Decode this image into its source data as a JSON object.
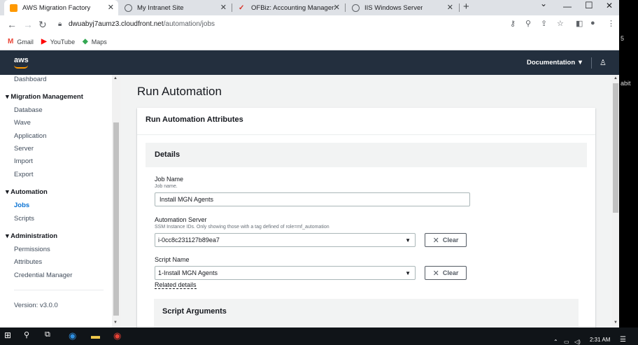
{
  "browser": {
    "tabs": [
      {
        "title": "AWS Migration Factory",
        "icon": "aws-cube-icon",
        "active": true
      },
      {
        "title": "My Intranet Site",
        "icon": "globe-icon",
        "active": false
      },
      {
        "title": "OFBiz: Accounting Manager: Log",
        "icon": "ofbiz-icon",
        "active": false
      },
      {
        "title": "IIS Windows Server",
        "icon": "globe-icon",
        "active": false
      }
    ],
    "url_host": "dwuabyj7aumz3.cloudfront.net",
    "url_path": "/automation/jobs",
    "bookmarks": [
      {
        "label": "Gmail",
        "icon": "gmail-icon"
      },
      {
        "label": "YouTube",
        "icon": "youtube-icon"
      },
      {
        "label": "Maps",
        "icon": "maps-icon"
      }
    ]
  },
  "header": {
    "logo": "aws",
    "documentation_label": "Documentation"
  },
  "sidebar": {
    "top_item": "Dashboard",
    "sections": [
      {
        "title": "Migration Management",
        "items": [
          "Database",
          "Wave",
          "Application",
          "Server",
          "Import",
          "Export"
        ]
      },
      {
        "title": "Automation",
        "items": [
          "Jobs",
          "Scripts"
        ]
      },
      {
        "title": "Administration",
        "items": [
          "Permissions",
          "Attributes",
          "Credential Manager"
        ]
      }
    ],
    "active_item": "Jobs",
    "version": "Version: v3.0.0"
  },
  "main": {
    "page_title": "Run Automation",
    "container_title": "Run Automation Attributes",
    "details_title": "Details",
    "job_name": {
      "label": "Job Name",
      "description": "Job name.",
      "value": "Install MGN Agents"
    },
    "automation_server": {
      "label": "Automation Server",
      "description": "SSM Instance IDs. Only showing those with a tag defined of role=mf_automation",
      "value": "i-0cc8c231127b89ea7",
      "clear_label": "Clear"
    },
    "script_name": {
      "label": "Script Name",
      "value": "1-Install MGN Agents",
      "clear_label": "Clear"
    },
    "related_details": "Related details",
    "script_arguments_title": "Script Arguments"
  },
  "desktop_edge": {
    "fragment_1": "5",
    "fragment_2": "abit"
  },
  "taskbar": {
    "time": "2:31 AM"
  }
}
